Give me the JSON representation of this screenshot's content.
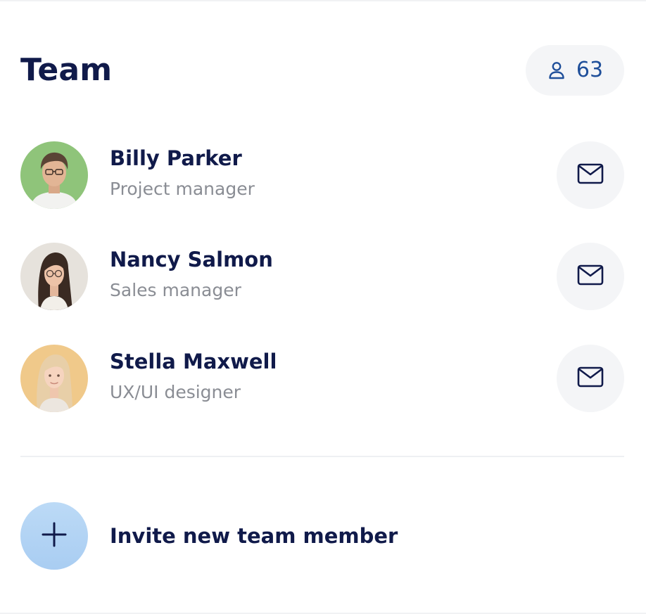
{
  "team": {
    "title": "Team",
    "member_count": "63",
    "count_icon": "user-icon"
  },
  "members": [
    {
      "name": "Billy Parker",
      "role": "Project manager",
      "avatar_bg": "#8fc47a",
      "action_icon": "mail-icon"
    },
    {
      "name": "Nancy Salmon",
      "role": "Sales manager",
      "avatar_bg": "#e6e2dc",
      "action_icon": "mail-icon"
    },
    {
      "name": "Stella Maxwell",
      "role": "UX/UI designer",
      "avatar_bg": "#f0c98a",
      "action_icon": "mail-icon"
    }
  ],
  "invite": {
    "label": "Invite new team member",
    "icon": "plus-icon"
  },
  "colors": {
    "heading": "#101a4a",
    "subtext": "#8a8d94",
    "accent": "#1f4f9a",
    "pill_bg": "#f4f5f7",
    "invite_bg": "#b7d6f5"
  }
}
